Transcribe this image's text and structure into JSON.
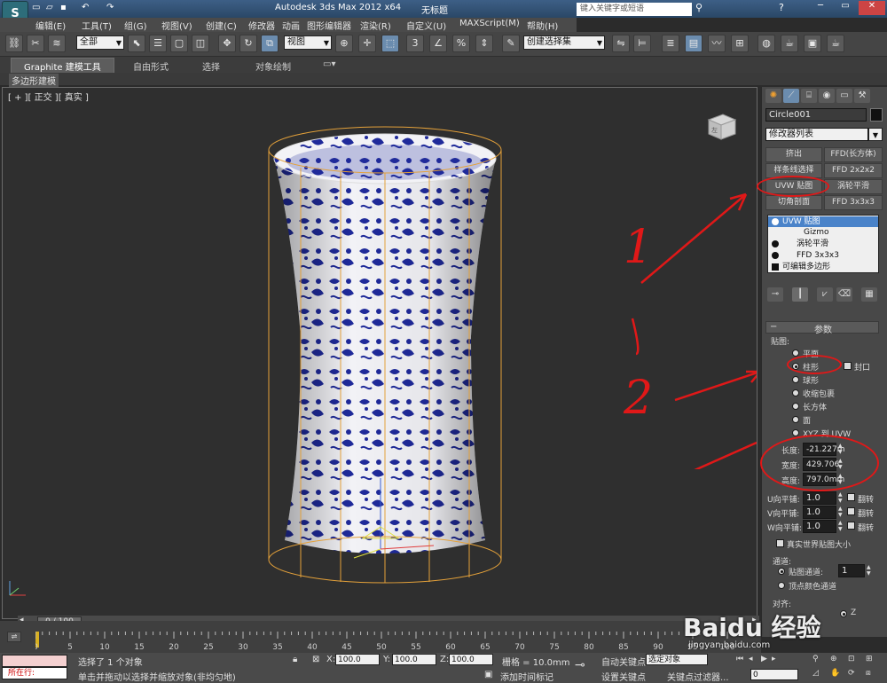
{
  "title": {
    "app": "Autodesk 3ds Max  2012 x64",
    "doc": "无标题",
    "search_placeholder": "键入关键字或短语"
  },
  "menu": [
    "编辑(E)",
    "工具(T)",
    "组(G)",
    "视图(V)",
    "创建(C)",
    "修改器",
    "动画",
    "图形编辑器",
    "渲染(R)",
    "自定义(U)",
    "MAXScript(M)",
    "帮助(H)"
  ],
  "toolbar": {
    "selection_filter": "全部",
    "ref_coord": "视图",
    "named_selection": "创建选择集"
  },
  "ribbon": {
    "tabs": [
      "Graphite 建模工具",
      "自由形式",
      "选择",
      "对象绘制"
    ],
    "sub": "多边形建模"
  },
  "viewport": {
    "label": "[ + ][ 正交 ][ 真实 ]",
    "cube_label": "左"
  },
  "panel": {
    "object_name": "Circle001",
    "modifier_list": "修改器列表",
    "buttons": [
      [
        "挤出",
        "FFD(长方体)"
      ],
      [
        "样条线选择",
        "FFD 2x2x2"
      ],
      [
        "UVW 贴图",
        "涡轮平滑"
      ],
      [
        "切角剖面",
        "FFD 3x3x3"
      ]
    ],
    "stack": [
      "UVW 贴图",
      "Gizmo",
      "涡轮平滑",
      "FFD 3x3x3",
      "可编辑多边形"
    ],
    "rollout": "参数",
    "mapping_label": "贴图:",
    "mapping": [
      "平面",
      "柱形",
      "球形",
      "收缩包裹",
      "长方体",
      "面",
      "XYZ 到 UVW"
    ],
    "mapping_selected": "柱形",
    "cap_label": "封口",
    "length_label": "长度:",
    "length": "-21.227m",
    "width_label": "宽度:",
    "width": "429.706",
    "height_label": "高度:",
    "height": "797.0mm",
    "utile_label": "U向平铺:",
    "utile": "1.0",
    "vtile_label": "V向平铺:",
    "vtile": "1.0",
    "wtile_label": "W向平铺:",
    "wtile": "1.0",
    "flip_label": "翻转",
    "realworld": "真实世界贴图大小",
    "channel_group": "通道:",
    "map_channel_label": "贴图通道:",
    "map_channel": "1",
    "vertex_color": "顶点颜色通道",
    "align_label": "对齐:",
    "align_z": "Z"
  },
  "annotations": {
    "one": "1",
    "two": "2"
  },
  "timeline": {
    "frame": "0 / 100",
    "ticks": [
      "0",
      "5",
      "10",
      "15",
      "20",
      "25",
      "30",
      "35",
      "40",
      "45",
      "50",
      "55",
      "60",
      "65",
      "70",
      "75",
      "80",
      "85",
      "90",
      "95",
      "100"
    ]
  },
  "status": {
    "running": "所在行:",
    "selected": "选择了 1 个对象",
    "hint": "单击并拖动以选择并缩放对象(非均匀地)",
    "x_label": "X:",
    "x": "100.0",
    "y_label": "Y:",
    "y": "100.0",
    "z_label": "Z:",
    "z": "100.0",
    "grid": "栅格 = 10.0mm",
    "add_time_tag": "添加时间标记",
    "autokey": "自动关键点",
    "selected_obj": "选定对象",
    "setkey": "设置关键点",
    "key_filters": "关键点过滤器...",
    "frame_field": "0"
  },
  "watermark": "Baidu 经验",
  "watermark_url": "jingyan.baidu.com"
}
